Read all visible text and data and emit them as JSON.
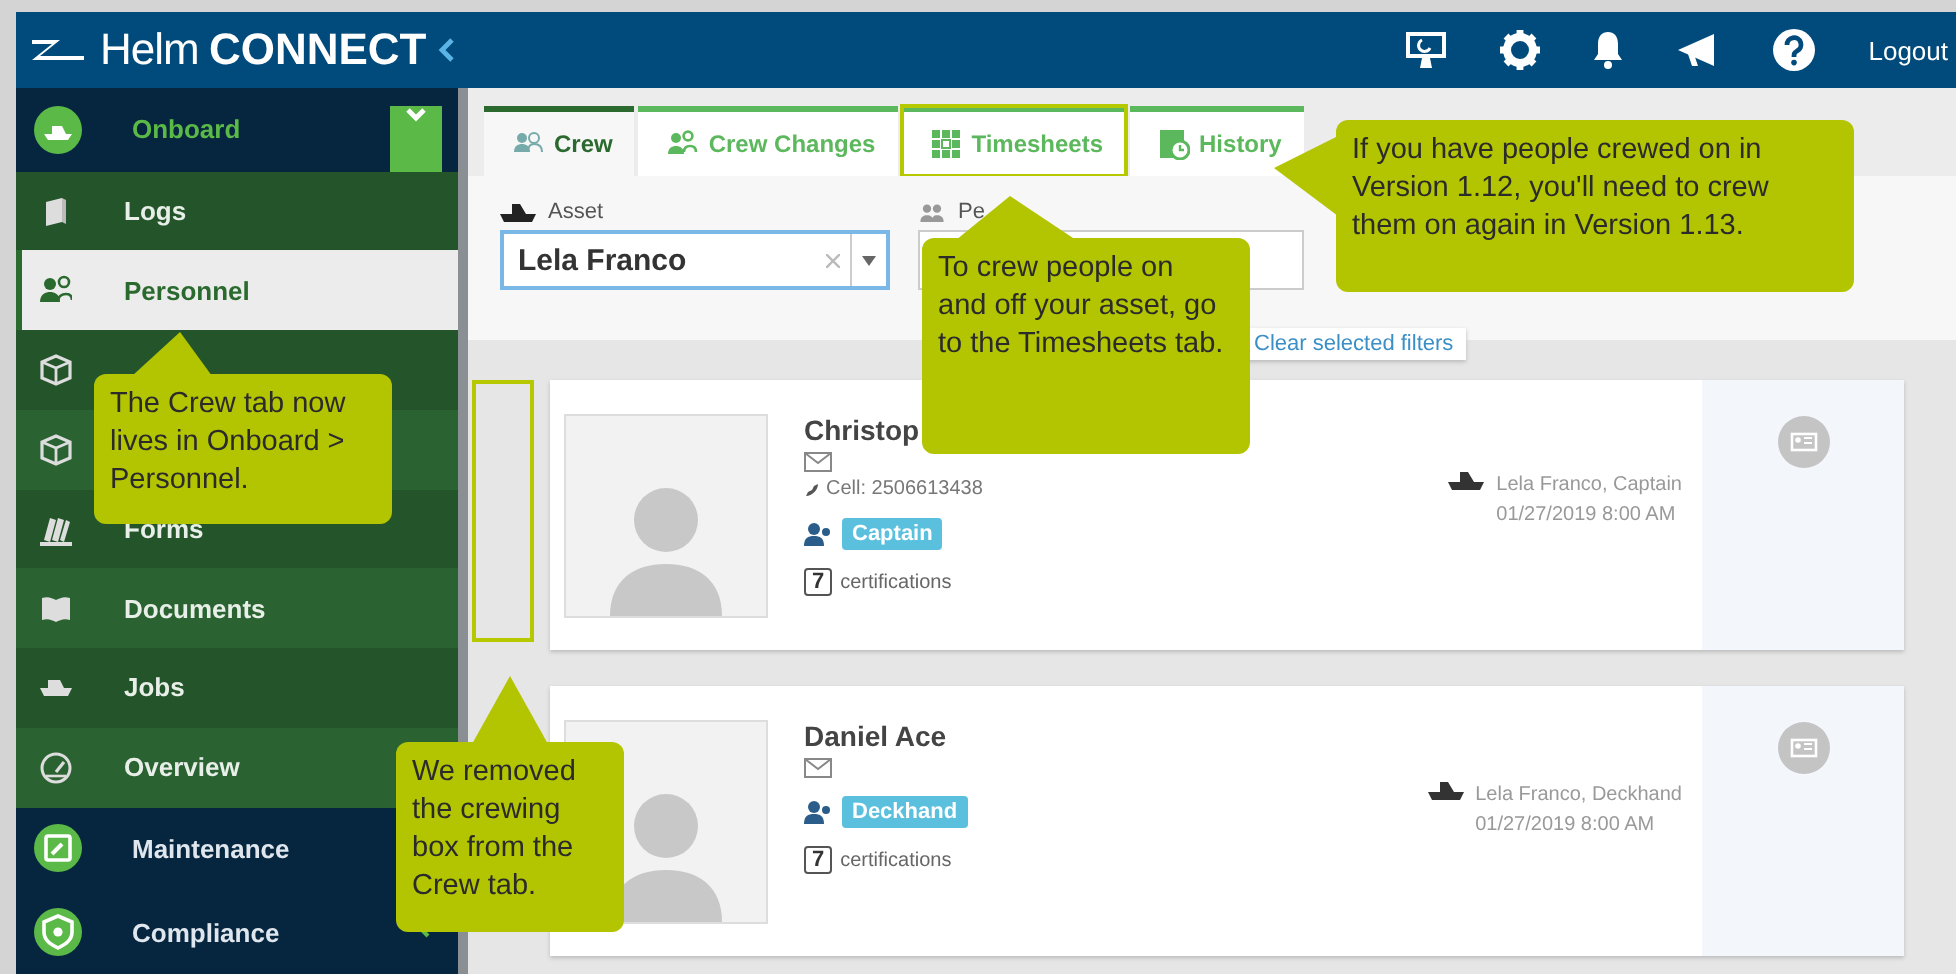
{
  "header": {
    "logo_light": "Helm",
    "logo_bold": "CONNECT",
    "logout": "Logout"
  },
  "sidebar": {
    "module": {
      "label": "Onboard",
      "expanded": true
    },
    "items": [
      {
        "label": "Logs",
        "selected": false
      },
      {
        "label": "Personnel",
        "selected": true
      },
      {
        "selected": false
      },
      {
        "selected": false
      },
      {
        "label": "Forms",
        "selected": false
      },
      {
        "label": "Documents",
        "selected": false
      },
      {
        "label": "Jobs",
        "selected": false
      },
      {
        "label": "Overview",
        "selected": false
      }
    ],
    "modules": [
      {
        "label": "Maintenance"
      },
      {
        "label": "Compliance"
      }
    ]
  },
  "tabs": [
    {
      "label": "Crew",
      "selected": true,
      "highlighted": false
    },
    {
      "label": "Crew Changes",
      "selected": false,
      "highlighted": false
    },
    {
      "label": "Timesheets",
      "selected": false,
      "highlighted": true
    },
    {
      "label": "History",
      "selected": false,
      "highlighted": false
    }
  ],
  "filters": {
    "asset": {
      "label": "Asset",
      "value": "Lela Franco"
    },
    "personnel": {
      "label": "Pe"
    },
    "clear": "Clear selected filters"
  },
  "crew": [
    {
      "name": "Christop",
      "cell": "Cell: 2506613438",
      "role": "Captain",
      "certifications_count": "7",
      "certifications_label": "certifications",
      "assignment": "Lela Franco, Captain",
      "date": "01/27/2019 8:00 AM"
    },
    {
      "name": "Daniel Ace",
      "role": "Deckhand",
      "certifications_count": "7",
      "certifications_label": "certifications",
      "assignment": "Lela Franco, Deckhand",
      "date": "01/27/2019 8:00 AM"
    }
  ],
  "callouts": [
    {
      "text": "The Crew tab now lives in Onboard > Personnel."
    },
    {
      "text": "To crew people on and off your asset, go to the Timesheets tab."
    },
    {
      "text": "If you have people crewed on in Version 1.12, you'll need to crew them on again in Version 1.13."
    },
    {
      "text": "We removed the crewing box from the Crew tab."
    }
  ]
}
